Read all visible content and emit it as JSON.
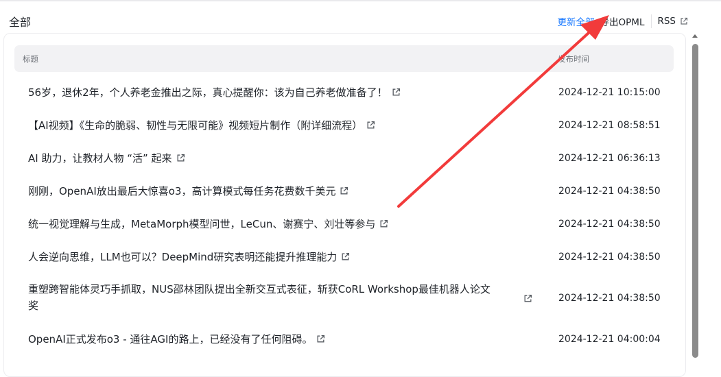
{
  "header": {
    "title": "全部",
    "refresh_all": "更新全部",
    "export_opml": "导出OPML",
    "rss": "RSS"
  },
  "table": {
    "col_title": "标题",
    "col_time": "发布时间"
  },
  "articles": [
    {
      "title": "56岁，退休2年，个人养老金推出之际，真心提醒你：该为自己养老做准备了！",
      "time": "2024-12-21 10:15:00"
    },
    {
      "title": "【AI视频】《生命的脆弱、韧性与无限可能》视频短片制作（附详细流程）",
      "time": "2024-12-21 08:58:51"
    },
    {
      "title": "AI 助力，让教材人物 “活” 起来",
      "time": "2024-12-21 06:36:13"
    },
    {
      "title": "刚刚，OpenAI放出最后大惊喜o3，高计算模式每任务花费数千美元",
      "time": "2024-12-21 04:38:50"
    },
    {
      "title": "统一视觉理解与生成，MetaMorph模型问世，LeCun、谢赛宁、刘壮等参与",
      "time": "2024-12-21 04:38:50"
    },
    {
      "title": "人会逆向思维，LLM也可以？DeepMind研究表明还能提升推理能力",
      "time": "2024-12-21 04:38:50"
    },
    {
      "title_line1": "重塑跨智能体灵巧手抓取，NUS邵林团队提出全新交互式表征，斩获CoRL Workshop最佳机器人论文",
      "title_line2": "奖",
      "time": "2024-12-21 04:38:50"
    },
    {
      "title": "OpenAI正式发布o3 - 通往AGI的路上，已经没有了任何阻碍。",
      "time": "2024-12-21 04:00:04"
    }
  ],
  "icons": {
    "external_link": "external-link-icon",
    "annotation": "red-arrow"
  },
  "colors": {
    "accent": "#1677ff",
    "annotation_arrow": "#f23b3b",
    "header_bg": "#f2f2f4"
  }
}
